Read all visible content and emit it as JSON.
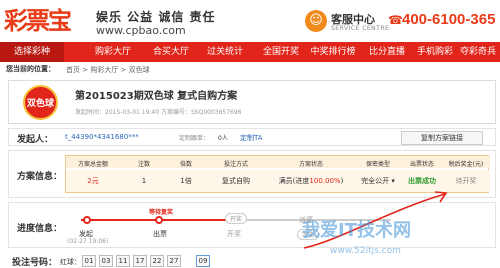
{
  "header": {
    "logo": "彩票宝",
    "slogan": "娱乐 公益 诚信 责任",
    "domain": "www.cpbao.com",
    "service_title": "客服中心",
    "service_sub": "SERVICE CENTRE",
    "phone": "400-6100-365"
  },
  "nav": [
    "选择彩种",
    "购彩大厅",
    "合买大厅",
    "过关统计",
    "全国开奖",
    "中奖排行榜",
    "比分直播",
    "手机购彩",
    "夺彩奇兵"
  ],
  "breadcrumb": {
    "label": "您当前的位置：",
    "path": "首页 > 购彩大厅 > 双色球"
  },
  "plan_card": {
    "ball_text": "双色球",
    "title": "第2015023期双色球  复式自购方案",
    "meta": "发起时间：2015-03-01 19:40  方案编号：SSQ0003657696"
  },
  "initiator": {
    "label": "发起人：",
    "name": "t_44390*4341680***",
    "count_label": "定制跟单：",
    "count": "0人",
    "link": "定制TA",
    "copy_button": "复制方案链接"
  },
  "plan_info": {
    "label": "方案信息：",
    "headers": [
      "方案总金额",
      "注数",
      "倍数",
      "投注方式",
      "方案状态",
      "保密类型",
      "出票状态",
      "税后奖金(元)"
    ],
    "row": {
      "amount": "2元",
      "notes": "1",
      "multiple": "1倍",
      "method": "复式自购",
      "status_prefix": "满员(进度",
      "status_pct": "100.00%",
      "status_suffix": ")",
      "secrecy": "完全公开",
      "ticket": "出票成功",
      "prize": "待开奖"
    }
  },
  "progress": {
    "label": "进度信息：",
    "flag": "等待复奖",
    "steps": [
      {
        "name": "发起",
        "time": "(02-27 19:06)",
        "active": true
      },
      {
        "name": "出票",
        "active": true
      },
      {
        "name": "开奖",
        "active": false
      },
      {
        "name": "派奖",
        "active": false
      }
    ],
    "pills": [
      "开奖",
      "派奖"
    ]
  },
  "picks": {
    "label": "投注号码：",
    "type": "红球：",
    "numbers": [
      "01",
      "03",
      "11",
      "17",
      "22",
      "27",
      "09"
    ]
  },
  "watermark": {
    "text": "我爱IT技术网",
    "url": "www.52itjs.com"
  },
  "colors": {
    "brand": "#e2251a",
    "orange": "#f08a1c",
    "success": "#2d9a2d"
  }
}
